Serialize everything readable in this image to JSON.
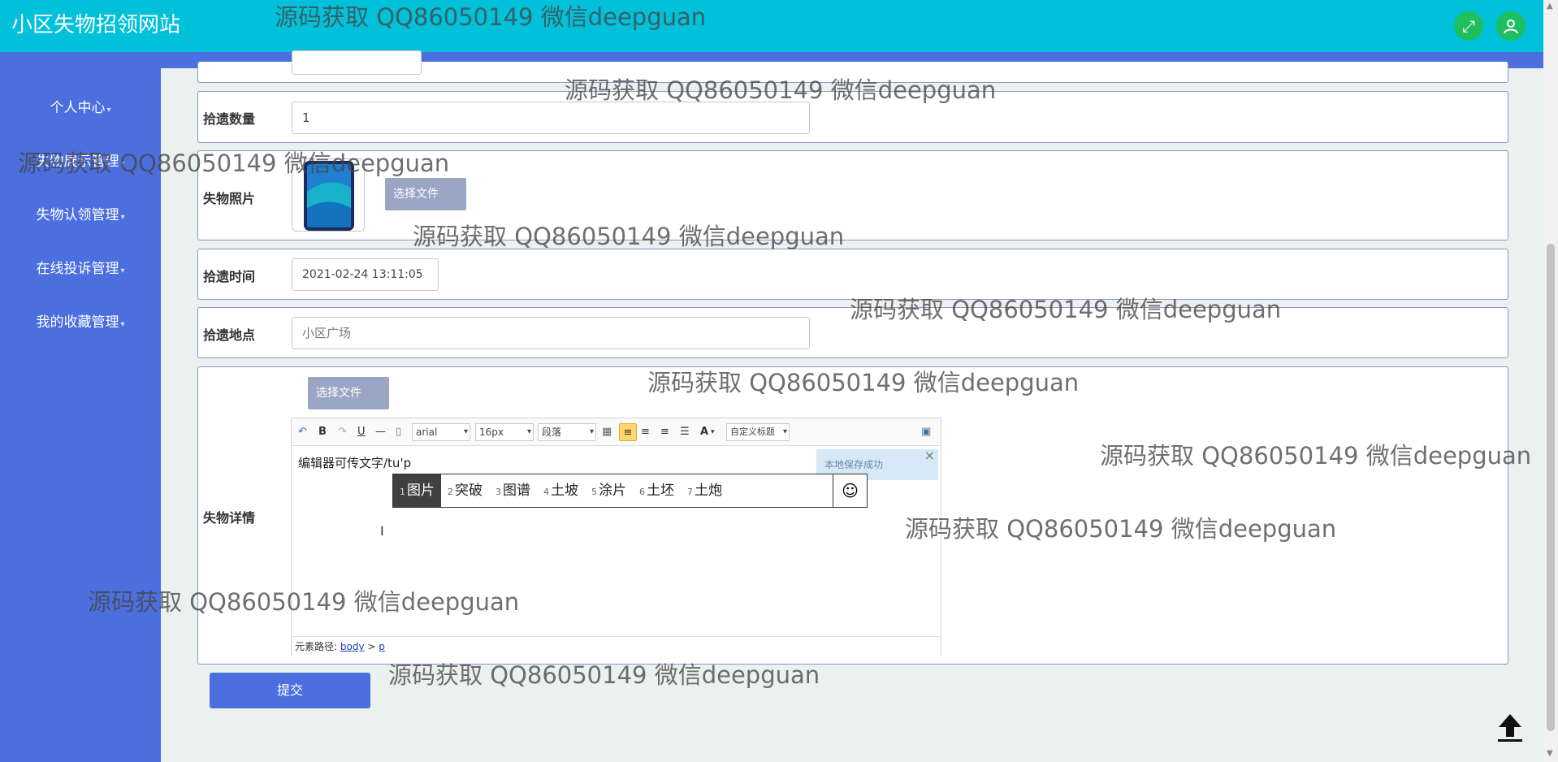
{
  "header": {
    "title": "小区失物招领网站",
    "fullscreen_icon": "expand-icon",
    "user_icon": "user-icon"
  },
  "sidebar": {
    "items": [
      {
        "label": "个人中心"
      },
      {
        "label": "失物展示管理"
      },
      {
        "label": "失物认领管理"
      },
      {
        "label": "在线投诉管理"
      },
      {
        "label": "我的收藏管理"
      }
    ],
    "caret": "▾"
  },
  "form": {
    "quantity": {
      "label": "拾遗数量",
      "value": "1"
    },
    "photo": {
      "label": "失物照片",
      "file_button": "选择文件"
    },
    "time": {
      "label": "拾遗时间",
      "value": "2021-02-24 13:11:05"
    },
    "place": {
      "label": "拾遗地点",
      "placeholder": "小区广场"
    },
    "detail": {
      "label": "失物详情",
      "file_button": "选择文件"
    },
    "submit_label": "提交"
  },
  "editor": {
    "toolbar": {
      "font_family": "arial",
      "font_size": "16px",
      "paragraph": "段落",
      "custom_title": "自定义标题",
      "bold": "B",
      "underline": "U",
      "font_color": "A"
    },
    "content": "编辑器可传文字/tu'p",
    "saved_tip": "本地保存成功",
    "close": "×",
    "path_label": "元素路径:",
    "path_body": "body",
    "path_sep": ">",
    "path_p": "p"
  },
  "ime": {
    "candidates": [
      {
        "num": "1",
        "text": "图片"
      },
      {
        "num": "2",
        "text": "突破"
      },
      {
        "num": "3",
        "text": "图谱"
      },
      {
        "num": "4",
        "text": "土坡"
      },
      {
        "num": "5",
        "text": "涂片"
      },
      {
        "num": "6",
        "text": "土坯"
      },
      {
        "num": "7",
        "text": "土炮"
      }
    ],
    "emoji": "☺"
  },
  "watermark": "源码获取 QQ86050149 微信deepguan",
  "back_to_top": "🡅"
}
